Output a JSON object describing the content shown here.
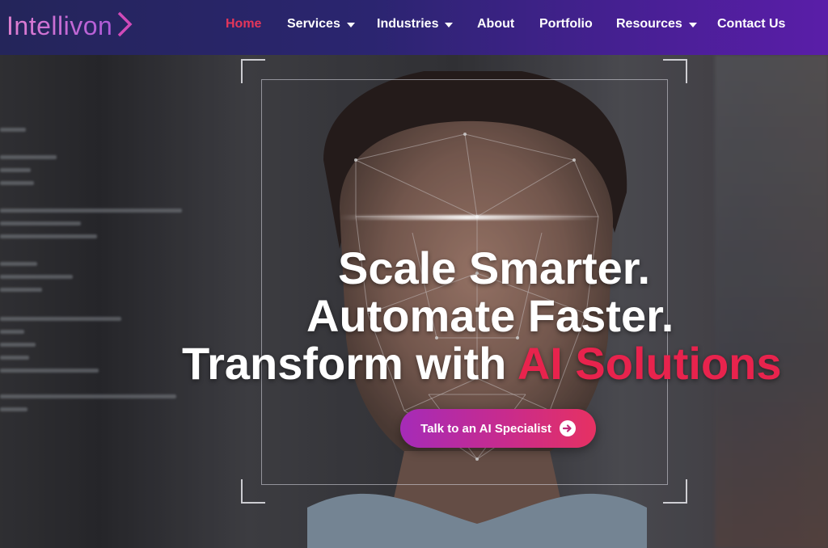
{
  "brand": {
    "logo_text": "Intellivon",
    "logo_icon": "chevron-right-icon",
    "colors": {
      "logo": "#c86fcf",
      "accent": "#e8234d"
    }
  },
  "nav": {
    "items": [
      {
        "label": "Home",
        "active": true,
        "has_dropdown": false
      },
      {
        "label": "Services",
        "active": false,
        "has_dropdown": true
      },
      {
        "label": "Industries",
        "active": false,
        "has_dropdown": true
      },
      {
        "label": "About",
        "active": false,
        "has_dropdown": false
      },
      {
        "label": "Portfolio",
        "active": false,
        "has_dropdown": false
      },
      {
        "label": "Resources",
        "active": false,
        "has_dropdown": true
      },
      {
        "label": "Contact Us",
        "active": false,
        "has_dropdown": false
      }
    ],
    "active_color": "#e4365a"
  },
  "hero": {
    "headline_line1": "Scale Smarter.",
    "headline_line2": "Automate Faster.",
    "headline_line3_prefix": "Transform with ",
    "headline_line3_accent": "AI Solutions",
    "cta_label": "Talk to an AI Specialist",
    "cta_icon": "arrow-right-circle-icon"
  }
}
